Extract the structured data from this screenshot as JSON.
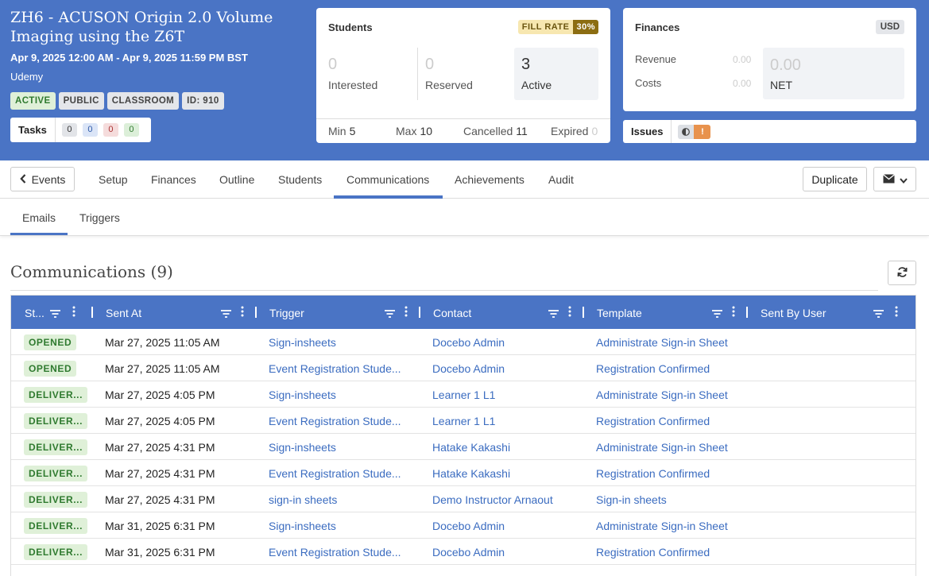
{
  "event": {
    "title": "ZH6 - ACUSON Origin 2.0 Volume Imaging using the Z6T",
    "dates": "Apr 9, 2025 12:00 AM - Apr 9, 2025 11:59 PM BST",
    "vendor": "Udemy",
    "badges": [
      "ACTIVE",
      "PUBLIC",
      "CLASSROOM",
      "ID: 910"
    ]
  },
  "tasks": {
    "label": "Tasks",
    "counts": [
      "0",
      "0",
      "0",
      "0"
    ]
  },
  "students": {
    "title": "Students",
    "fill_rate_label": "FILL RATE",
    "fill_rate_value": "30%",
    "interested": {
      "value": "0",
      "label": "Interested"
    },
    "reserved": {
      "value": "0",
      "label": "Reserved"
    },
    "active": {
      "value": "3",
      "label": "Active"
    },
    "min_label": "Min",
    "min_value": "5",
    "max_label": "Max",
    "max_value": "10",
    "cancelled_label": "Cancelled",
    "cancelled_value": "11",
    "expired_label": "Expired",
    "expired_value": "0"
  },
  "finances": {
    "title": "Finances",
    "currency": "USD",
    "revenue_label": "Revenue",
    "revenue_value": "0.00",
    "costs_label": "Costs",
    "costs_value": "0.00",
    "net_value": "0.00",
    "net_label": "NET"
  },
  "issues": {
    "label": "Issues",
    "warning": "!"
  },
  "nav": {
    "back": "Events",
    "tabs": [
      "Setup",
      "Finances",
      "Outline",
      "Students",
      "Communications",
      "Achievements",
      "Audit"
    ],
    "active_tab": "Communications",
    "duplicate": "Duplicate"
  },
  "subnav": {
    "tabs": [
      "Emails",
      "Triggers"
    ],
    "active": "Emails"
  },
  "section": {
    "title": "Communications (9)"
  },
  "table": {
    "columns": [
      "St...",
      "Sent At",
      "Trigger",
      "Contact",
      "Template",
      "Sent By User"
    ],
    "rows": [
      {
        "status": "OPENED",
        "sent_at": "Mar 27, 2025 11:05 AM",
        "trigger": "Sign-insheets",
        "contact": "Docebo Admin",
        "template": "Administrate Sign-in Sheet",
        "sent_by": ""
      },
      {
        "status": "OPENED",
        "sent_at": "Mar 27, 2025 11:05 AM",
        "trigger": "Event Registration Stude...",
        "contact": "Docebo Admin",
        "template": "Registration Confirmed",
        "sent_by": ""
      },
      {
        "status": "DELIVER...",
        "sent_at": "Mar 27, 2025 4:05 PM",
        "trigger": "Sign-insheets",
        "contact": "Learner 1 L1",
        "template": "Administrate Sign-in Sheet",
        "sent_by": ""
      },
      {
        "status": "DELIVER...",
        "sent_at": "Mar 27, 2025 4:05 PM",
        "trigger": "Event Registration Stude...",
        "contact": "Learner 1 L1",
        "template": "Registration Confirmed",
        "sent_by": ""
      },
      {
        "status": "DELIVER...",
        "sent_at": "Mar 27, 2025 4:31 PM",
        "trigger": "Sign-insheets",
        "contact": "Hatake Kakashi",
        "template": "Administrate Sign-in Sheet",
        "sent_by": ""
      },
      {
        "status": "DELIVER...",
        "sent_at": "Mar 27, 2025 4:31 PM",
        "trigger": "Event Registration Stude...",
        "contact": "Hatake Kakashi",
        "template": "Registration Confirmed",
        "sent_by": ""
      },
      {
        "status": "DELIVER...",
        "sent_at": "Mar 27, 2025 4:31 PM",
        "trigger": "sign-in sheets",
        "contact": "Demo Instructor Arnaout",
        "template": "Sign-in sheets",
        "sent_by": ""
      },
      {
        "status": "DELIVER...",
        "sent_at": "Mar 31, 2025 6:31 PM",
        "trigger": "Sign-insheets",
        "contact": "Docebo Admin",
        "template": "Administrate Sign-in Sheet",
        "sent_by": ""
      },
      {
        "status": "DELIVER...",
        "sent_at": "Mar 31, 2025 6:31 PM",
        "trigger": "Event Registration Stude...",
        "contact": "Docebo Admin",
        "template": "Registration Confirmed",
        "sent_by": ""
      }
    ]
  },
  "colors": {
    "brand": "#4a74c5",
    "link": "#3b6cc0",
    "status_green": "#2f7a2f",
    "fill_rate": "#8c6d12",
    "warning": "#e8924d"
  },
  "icons": {
    "back": "chevron-left-icon",
    "filter": "filter-icon",
    "menu": "vertical-dots-icon",
    "refresh": "refresh-icon",
    "mail": "envelope-icon",
    "dropdown": "chevron-down-icon",
    "contrast": "half-circle-icon"
  }
}
